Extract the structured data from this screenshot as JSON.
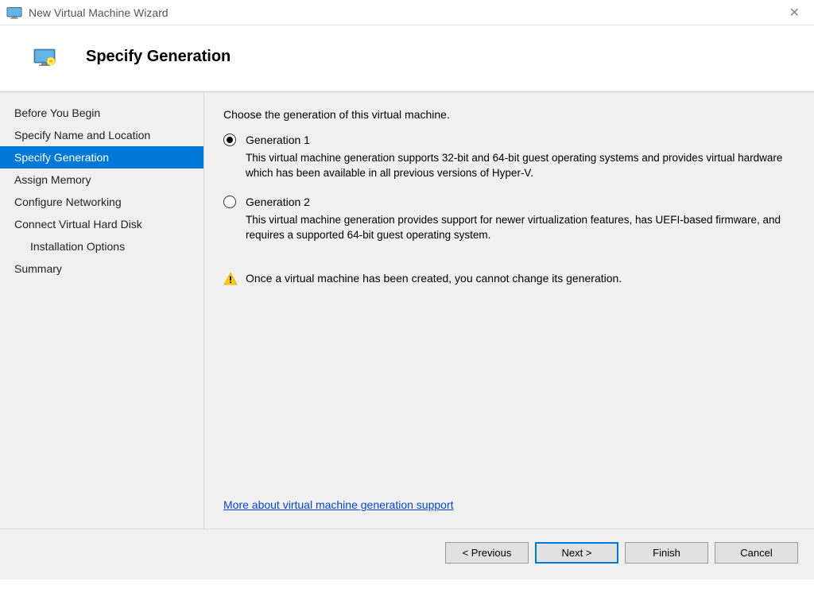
{
  "titleBar": {
    "title": "New Virtual Machine Wizard"
  },
  "header": {
    "title": "Specify Generation"
  },
  "sidebar": {
    "items": [
      {
        "label": "Before You Begin",
        "selected": false,
        "indented": false
      },
      {
        "label": "Specify Name and Location",
        "selected": false,
        "indented": false
      },
      {
        "label": "Specify Generation",
        "selected": true,
        "indented": false
      },
      {
        "label": "Assign Memory",
        "selected": false,
        "indented": false
      },
      {
        "label": "Configure Networking",
        "selected": false,
        "indented": false
      },
      {
        "label": "Connect Virtual Hard Disk",
        "selected": false,
        "indented": false
      },
      {
        "label": "Installation Options",
        "selected": false,
        "indented": true
      },
      {
        "label": "Summary",
        "selected": false,
        "indented": false
      }
    ]
  },
  "main": {
    "instruction": "Choose the generation of this virtual machine.",
    "options": [
      {
        "label": "Generation 1",
        "checked": true,
        "description": "This virtual machine generation supports 32-bit and 64-bit guest operating systems and provides virtual hardware which has been available in all previous versions of Hyper-V."
      },
      {
        "label": "Generation 2",
        "checked": false,
        "description": "This virtual machine generation provides support for newer virtualization features, has UEFI-based firmware, and requires a supported 64-bit guest operating system."
      }
    ],
    "warning": "Once a virtual machine has been created, you cannot change its generation.",
    "link": "More about virtual machine generation support"
  },
  "footer": {
    "previous": "< Previous",
    "next": "Next >",
    "finish": "Finish",
    "cancel": "Cancel"
  }
}
